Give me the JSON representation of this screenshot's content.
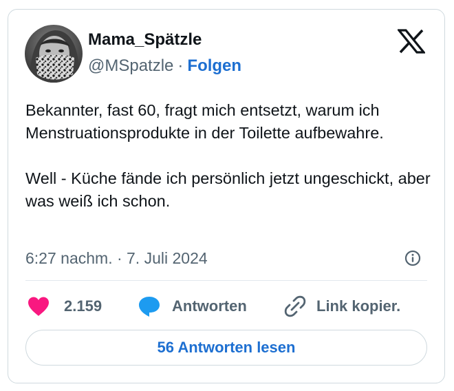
{
  "author": {
    "display_name": "Mama_Spätzle",
    "handle": "@MSpatzle",
    "separator": "·",
    "follow_label": "Folgen"
  },
  "tweet": {
    "paragraph_1": "Bekannter, fast 60, fragt mich entsetzt, warum ich Menstruationsprodukte in der Toilette aufbewahre.",
    "paragraph_2": "Well - Küche fände ich persönlich jetzt ungeschickt, aber was weiß ich schon."
  },
  "timestamp": "6:27 nachm. · 7. Juli 2024",
  "actions": {
    "like_count": "2.159",
    "reply_label": "Antworten",
    "copy_link_label": "Link kopier."
  },
  "read_replies_label": "56 Antworten lesen",
  "icons": {
    "logo": "x-logo-icon",
    "like": "heart-icon",
    "reply": "speech-bubble-icon",
    "copy": "link-icon",
    "info": "info-icon"
  },
  "colors": {
    "text": "#0f1419",
    "secondary": "#536471",
    "accent": "#1d6fd1",
    "like": "#f91880",
    "reply": "#1d9bf0",
    "border": "#cfd9de"
  }
}
